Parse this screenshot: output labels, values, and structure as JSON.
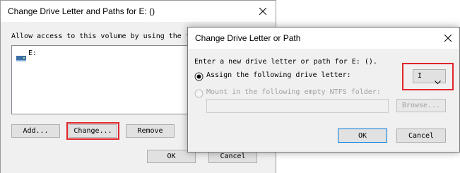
{
  "back_dialog": {
    "title": "Change Drive Letter and Paths for E: ()",
    "instruction": "Allow access to this volume by using the f",
    "list_items": [
      {
        "label": "E:",
        "icon": "drive-icon"
      }
    ],
    "buttons": {
      "add": "Add...",
      "change": "Change...",
      "remove": "Remove",
      "ok": "OK",
      "cancel": "Cancel"
    }
  },
  "front_dialog": {
    "title": "Change Drive Letter or Path",
    "instruction": "Enter a new drive letter or path for E: ().",
    "radio_assign": {
      "label": "Assign the following drive letter:",
      "selected": true
    },
    "drive_letter_select": {
      "value": "I"
    },
    "radio_mount": {
      "label": "Mount in the following empty NTFS folder:",
      "selected": false,
      "disabled": true
    },
    "folder_path": {
      "value": ""
    },
    "buttons": {
      "browse": "Browse...",
      "ok": "OK",
      "cancel": "Cancel"
    }
  },
  "colors": {
    "highlight": "#e0262b",
    "dialog_bg": "#f0f0f0",
    "accent": "#0078d7"
  }
}
